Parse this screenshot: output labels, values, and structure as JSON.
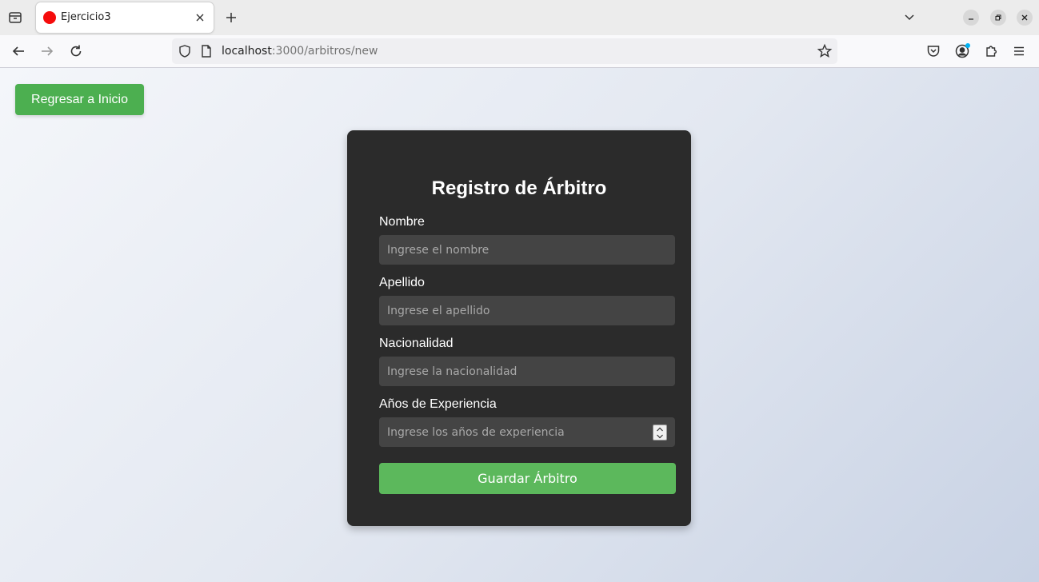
{
  "browser": {
    "tab": {
      "title": "Ejercicio3",
      "favicon_color": "#f50c0c"
    },
    "url": {
      "host": "localhost",
      "path": ":3000/arbitros/new"
    }
  },
  "page": {
    "back_button": "Regresar a Inicio",
    "form": {
      "title": "Registro de Árbitro",
      "fields": [
        {
          "label": "Nombre",
          "placeholder": "Ingrese el nombre",
          "value": ""
        },
        {
          "label": "Apellido",
          "placeholder": "Ingrese el apellido",
          "value": ""
        },
        {
          "label": "Nacionalidad",
          "placeholder": "Ingrese la nacionalidad",
          "value": ""
        },
        {
          "label": "Años de Experiencia",
          "placeholder": "Ingrese los años de experiencia",
          "value": ""
        }
      ],
      "submit_label": "Guardar Árbitro"
    }
  },
  "colors": {
    "primary_button": "#4caf50",
    "submit_button": "#5cb85c",
    "card_background": "#2b2b2b",
    "input_background": "#444444"
  },
  "icons": [
    "tab-list-icon",
    "close-icon",
    "plus-icon",
    "chevron-down-icon",
    "minimize-icon",
    "restore-icon",
    "back-arrow-icon",
    "forward-arrow-icon",
    "reload-icon",
    "shield-icon",
    "page-icon",
    "star-icon",
    "pocket-icon",
    "account-icon",
    "extensions-icon",
    "menu-icon",
    "spinner-icon"
  ]
}
